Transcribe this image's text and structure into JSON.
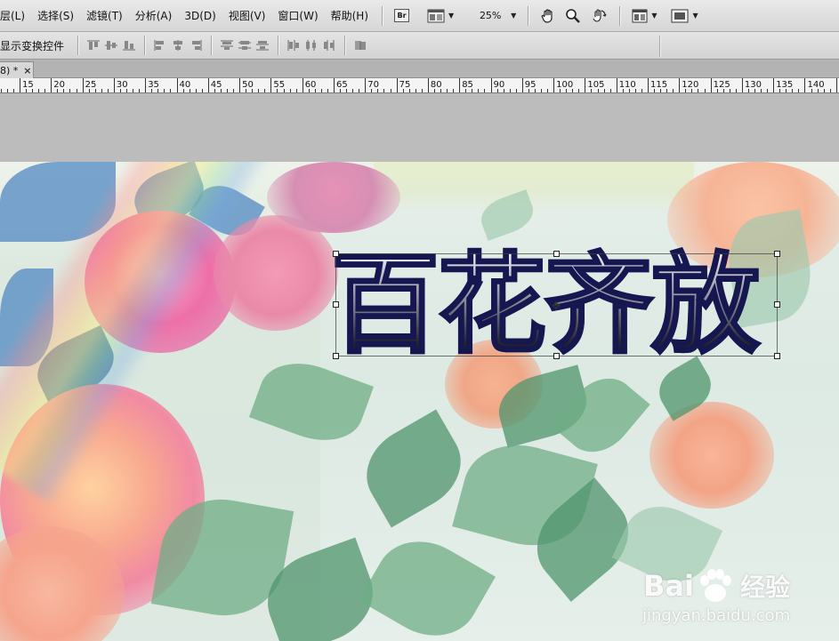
{
  "menubar": {
    "items": [
      "层(L)",
      "选择(S)",
      "滤镜(T)",
      "分析(A)",
      "3D(D)",
      "视图(V)",
      "窗口(W)",
      "帮助(H)"
    ],
    "bridge_label": "Br",
    "zoom_value": "25%",
    "icons": [
      "bridge-icon",
      "arrange-documents-icon",
      "hand-tool-icon",
      "zoom-tool-icon",
      "rotate-view-icon",
      "workspace-layout-icon",
      "screen-mode-icon"
    ]
  },
  "options_bar": {
    "show_transform_controls_label": "显示变换控件",
    "align_groups": [
      [
        "align-top-edges-icon",
        "align-vertical-centers-icon",
        "align-bottom-edges-icon"
      ],
      [
        "align-left-edges-icon",
        "align-horizontal-centers-icon",
        "align-right-edges-icon"
      ],
      [
        "distribute-top-icon",
        "distribute-vertical-centers-icon",
        "distribute-bottom-icon"
      ],
      [
        "distribute-left-icon",
        "distribute-horizontal-centers-icon",
        "distribute-right-icon"
      ],
      [
        "auto-align-layers-icon"
      ]
    ]
  },
  "document": {
    "tab_label": "8) *",
    "close_symbol": "×"
  },
  "ruler": {
    "labels": [
      "15",
      "20",
      "25",
      "30",
      "35",
      "40",
      "45",
      "50",
      "55",
      "60",
      "65",
      "70",
      "75",
      "80",
      "85",
      "90",
      "95",
      "100",
      "105",
      "110",
      "115",
      "120",
      "125",
      "130",
      "135",
      "140"
    ]
  },
  "canvas": {
    "title_text": "百花齐放",
    "watermark": {
      "logo_left": "Bai",
      "logo_right": "经验",
      "url": "jingyan.baidu.com"
    }
  },
  "colors": {
    "menubar_bg": "#dcdcdc",
    "workspace_bg": "#bcbcbc",
    "title_stroke": "#161650"
  }
}
